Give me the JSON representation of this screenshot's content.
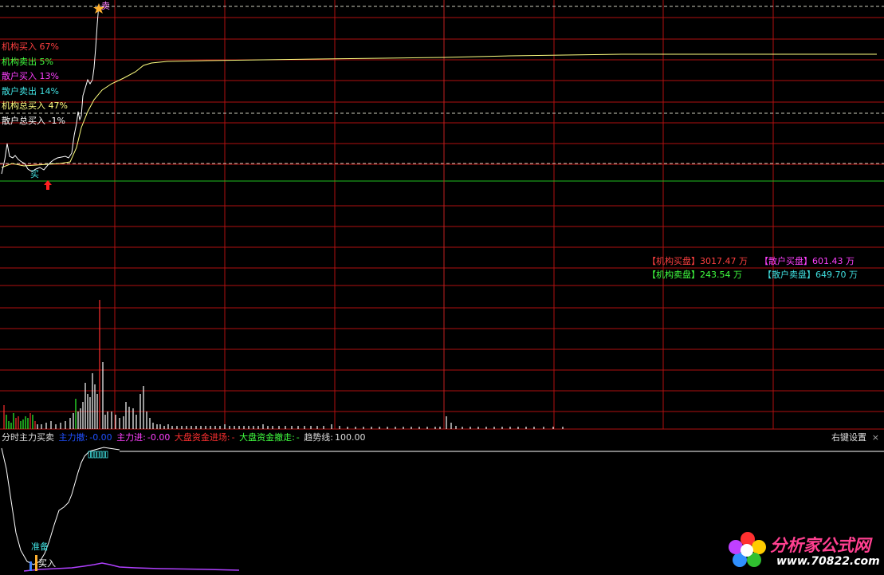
{
  "main": {
    "sell_marker": "卖",
    "buy_marker": "买",
    "legend": [
      {
        "label": "机构买入 67%",
        "color": "#ff4040"
      },
      {
        "label": "机构卖出 5%",
        "color": "#40ff40"
      },
      {
        "label": "散户买入 13%",
        "color": "#ff40ff"
      },
      {
        "label": "散户卖出 14%",
        "color": "#40e0e0"
      },
      {
        "label": "机构总买入 47%",
        "color": "#ffff80"
      },
      {
        "label": "散户总买入 -1%",
        "color": "#ffffff"
      }
    ],
    "orders_panel": {
      "inst_buy_label": "【机构买盘】",
      "inst_buy_value": "3017.47 万",
      "retail_buy_label": "【散户买盘】",
      "retail_buy_value": "601.43 万",
      "inst_sell_label": "【机构卖盘】",
      "inst_sell_value": "243.54 万",
      "retail_sell_label": "【散户卖盘】",
      "retail_sell_value": "649.70 万"
    }
  },
  "indicator": {
    "title": "分时主力买卖",
    "main_out_label": "主力撤:",
    "main_out_value": "-0.00",
    "main_in_label": "主力进:",
    "main_in_value": "-0.00",
    "market_in_label": "大盘资金进场:",
    "market_in_value": "-",
    "market_out_label": "大盘资金撤走:",
    "market_out_value": "-",
    "trend_label": "趋势线:",
    "trend_value": "100.00",
    "settings_label": "右键设置",
    "close_label": "×",
    "prepare_label": "准备",
    "buy_label": "买入"
  },
  "watermark": {
    "text_cn": "分析家公式网",
    "url": "www.70822.com"
  },
  "colors": {
    "grid_red": "#b01010",
    "price_white": "#ffffff",
    "avg_yellow": "#ffff80",
    "volume_red": "#ff3030",
    "volume_green": "#30ff30",
    "indicator_purple": "#b040ff"
  }
}
